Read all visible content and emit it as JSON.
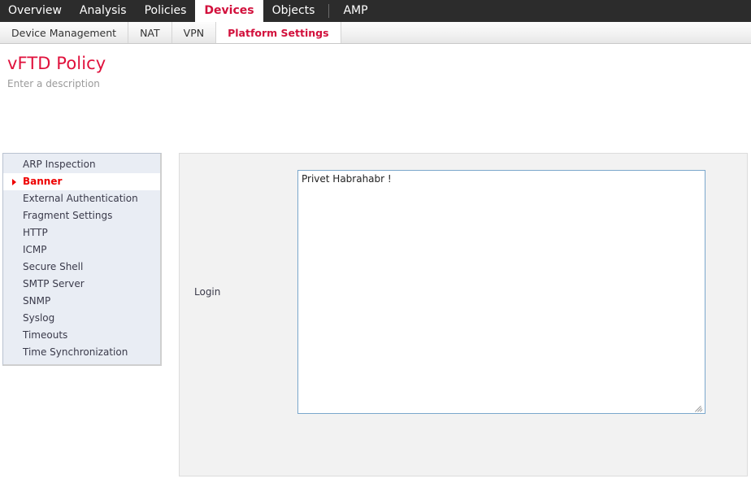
{
  "topnav": {
    "items": [
      {
        "label": "Overview",
        "active": false
      },
      {
        "label": "Analysis",
        "active": false
      },
      {
        "label": "Policies",
        "active": false
      },
      {
        "label": "Devices",
        "active": true
      },
      {
        "label": "Objects",
        "active": false
      },
      {
        "label": "AMP",
        "active": false
      }
    ],
    "separator_before": "AMP",
    "background_color": "#2c2c2c",
    "active_text_color": "#d2103c"
  },
  "subnav": {
    "items": [
      {
        "label": "Device Management",
        "active": false
      },
      {
        "label": "NAT",
        "active": false
      },
      {
        "label": "VPN",
        "active": false
      },
      {
        "label": "Platform Settings",
        "active": true
      }
    ],
    "active_text_color": "#d2103c"
  },
  "page": {
    "title": "vFTD Policy",
    "description": "Enter a description",
    "title_color": "#e0113c",
    "description_color": "#9a9a9a"
  },
  "sidebar": {
    "items": [
      {
        "label": "ARP Inspection",
        "active": false
      },
      {
        "label": "Banner",
        "active": true
      },
      {
        "label": "External Authentication",
        "active": false
      },
      {
        "label": "Fragment Settings",
        "active": false
      },
      {
        "label": "HTTP",
        "active": false
      },
      {
        "label": "ICMP",
        "active": false
      },
      {
        "label": "Secure Shell",
        "active": false
      },
      {
        "label": "SMTP Server",
        "active": false
      },
      {
        "label": "SNMP",
        "active": false
      },
      {
        "label": "Syslog",
        "active": false
      },
      {
        "label": "Timeouts",
        "active": false
      },
      {
        "label": "Time Synchronization",
        "active": false
      }
    ],
    "background_color": "#e9edf4",
    "active_text_color": "#ee0000",
    "selected_marker_icon": "caret-right-icon"
  },
  "main": {
    "login_banner": {
      "label": "Login",
      "value": "Privet Habrahabr !",
      "placeholder": "",
      "border_color": "#7ba7cc",
      "resize_handle_icon": "resize-grip-icon"
    }
  }
}
